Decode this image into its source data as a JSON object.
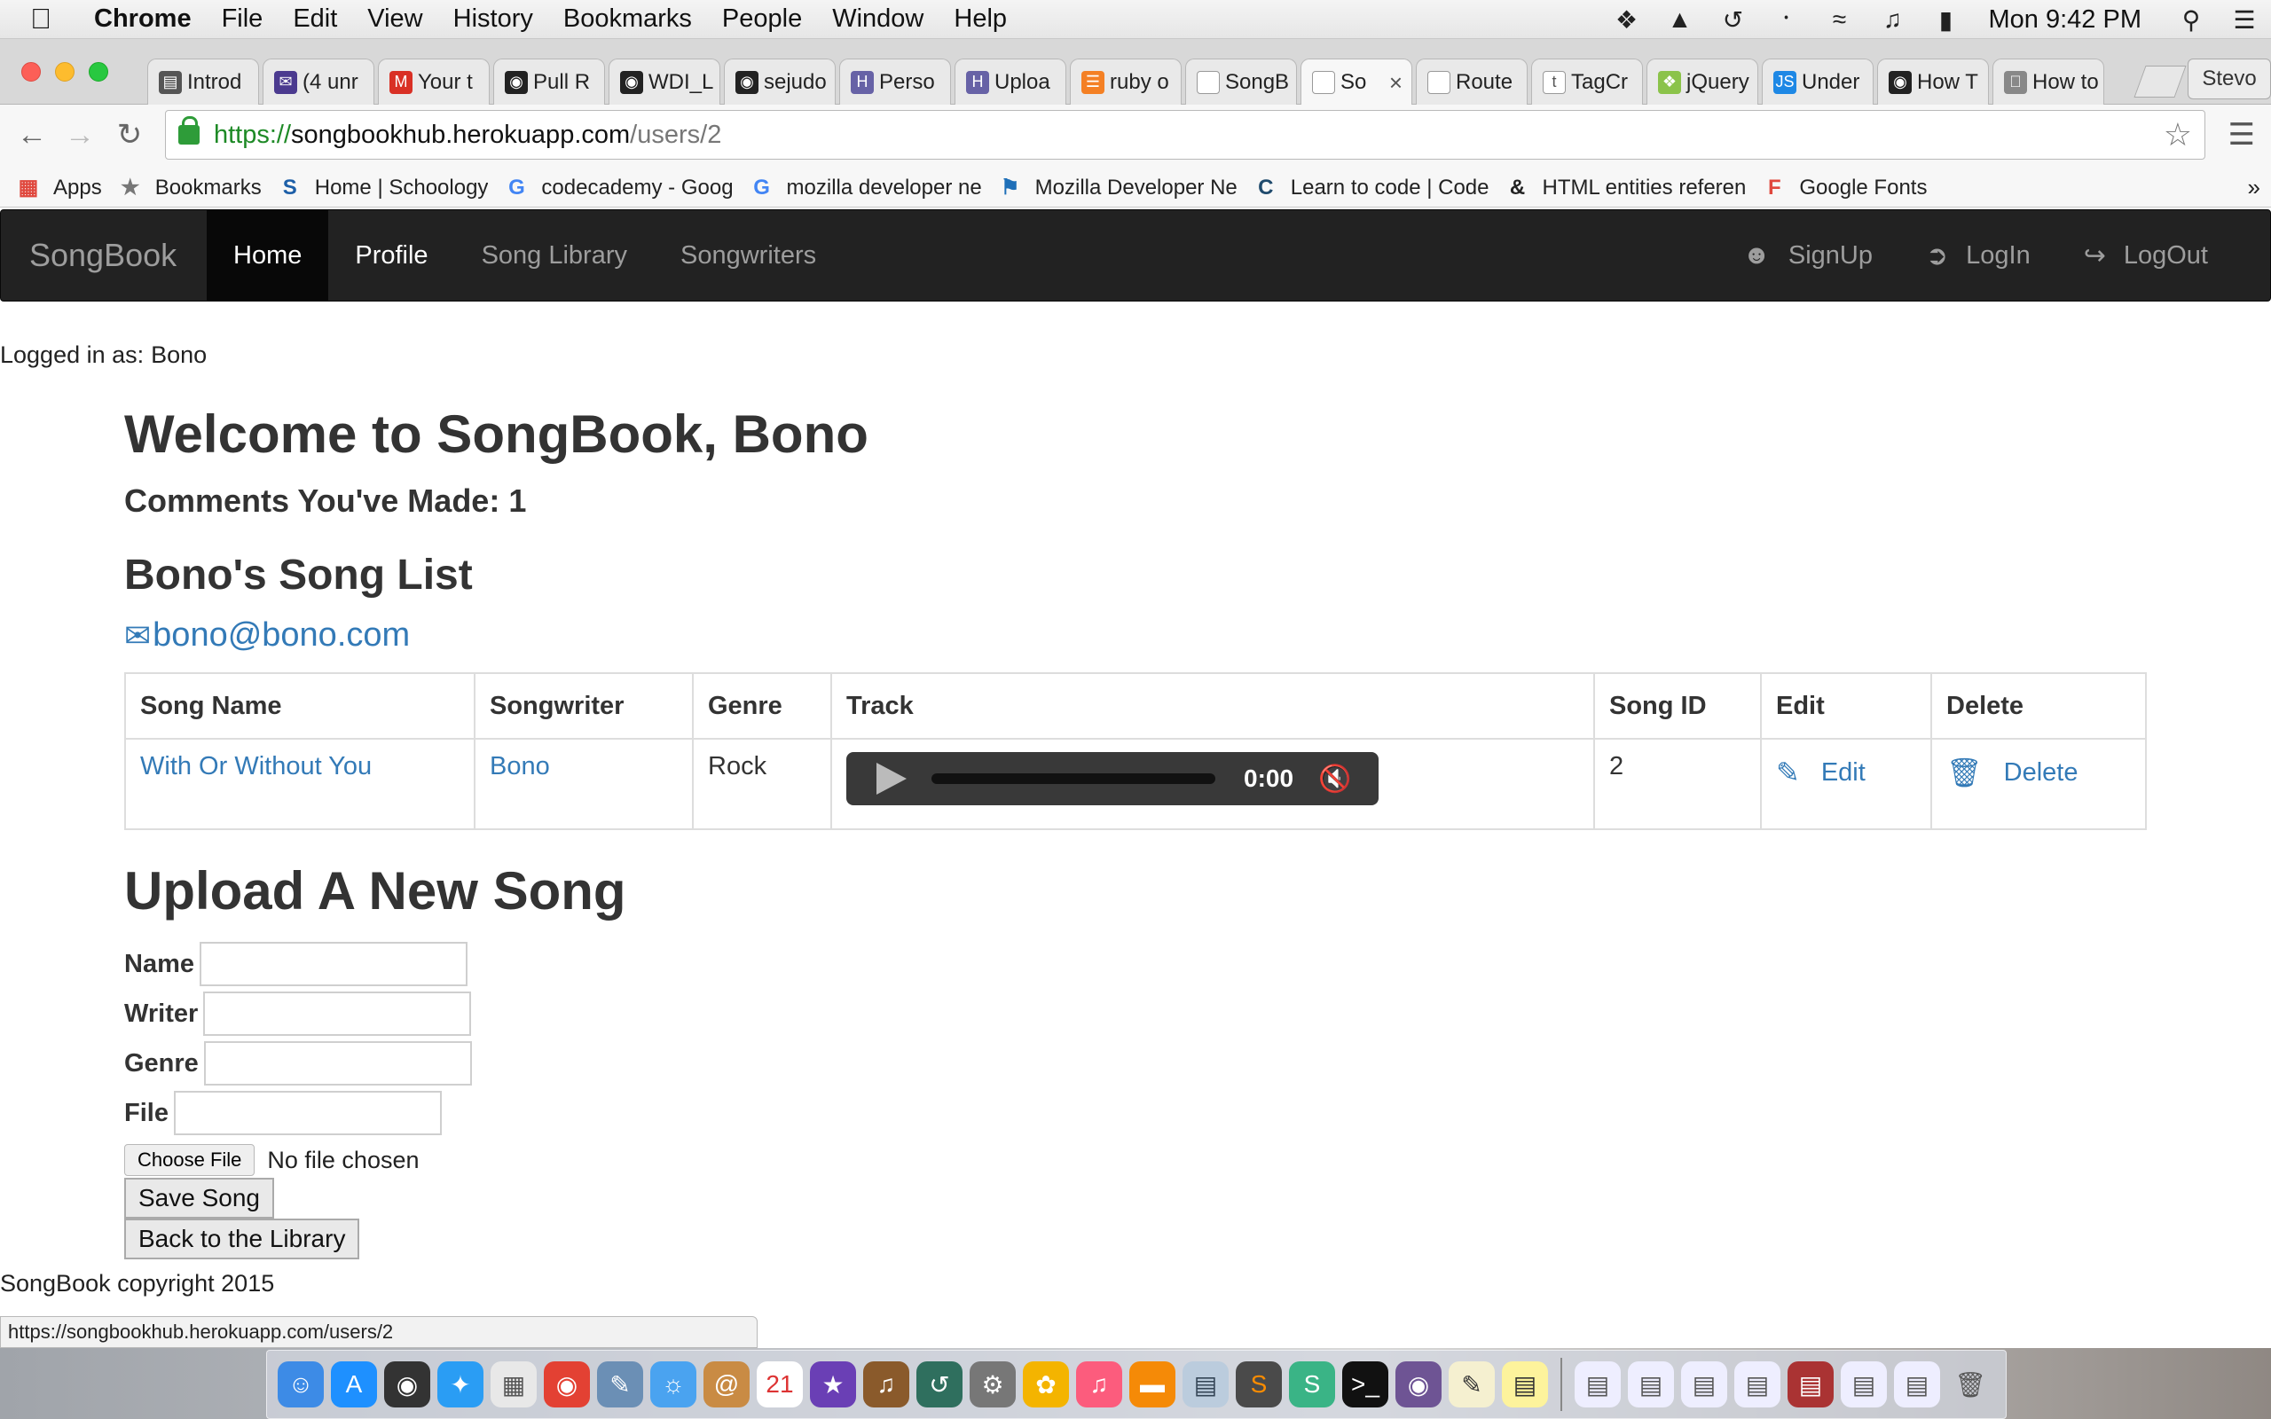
{
  "menubar": {
    "app_name": "Chrome",
    "menus": [
      "File",
      "Edit",
      "View",
      "History",
      "Bookmarks",
      "People",
      "Window",
      "Help"
    ],
    "clock": "Mon 9:42 PM"
  },
  "browser": {
    "profile_name": "Stevo",
    "tabs": [
      {
        "label": "Introd",
        "icon": "book-icon",
        "color": "#555555"
      },
      {
        "label": "(4 unr",
        "icon": "mail-icon",
        "color": "#4b3a8f"
      },
      {
        "label": "Your t",
        "icon": "gmail-icon",
        "color": "#d93025"
      },
      {
        "label": "Pull R",
        "icon": "github-icon",
        "color": "#222222"
      },
      {
        "label": "WDI_L",
        "icon": "github-icon",
        "color": "#222222"
      },
      {
        "label": "sejudo",
        "icon": "github-icon",
        "color": "#222222"
      },
      {
        "label": "Perso",
        "icon": "heroku-icon",
        "color": "#6762a6"
      },
      {
        "label": "Uploa",
        "icon": "heroku-icon",
        "color": "#6762a6"
      },
      {
        "label": "ruby o",
        "icon": "stackoverflow-icon",
        "color": "#f48024"
      },
      {
        "label": "SongB",
        "icon": "page-icon",
        "color": "#ffffff"
      },
      {
        "label": "So",
        "icon": "page-icon",
        "color": "#ffffff",
        "active": true
      },
      {
        "label": "Route",
        "icon": "page-icon",
        "color": "#ffffff"
      },
      {
        "label": "TagCr",
        "icon": "tagcrowd-icon",
        "color": "#ffffff"
      },
      {
        "label": "jQuery",
        "icon": "jquery-icon",
        "color": "#8bc34a"
      },
      {
        "label": "Under",
        "icon": "js-icon",
        "color": "#1e88e5"
      },
      {
        "label": "How T",
        "icon": "github-icon",
        "color": "#222222"
      },
      {
        "label": "How to",
        "icon": "apple-icon",
        "color": "#888888"
      }
    ],
    "url": {
      "scheme": "https://",
      "host": "songbookhub.herokuapp.com",
      "path": "/users/2"
    },
    "bookmarks": [
      {
        "label": "Apps",
        "icon": "apps-grid-icon"
      },
      {
        "label": "Bookmarks",
        "icon": "star-icon"
      },
      {
        "label": "Home | Schoology",
        "icon": "schoology-icon"
      },
      {
        "label": "codecademy - Goog",
        "icon": "google-icon"
      },
      {
        "label": "mozilla developer ne",
        "icon": "google-icon"
      },
      {
        "label": "Mozilla Developer Ne",
        "icon": "mdn-icon"
      },
      {
        "label": "Learn to code | Code",
        "icon": "codecademy-icon"
      },
      {
        "label": "HTML entities referen",
        "icon": "ampersand-icon"
      },
      {
        "label": "Google Fonts",
        "icon": "google-fonts-icon"
      }
    ],
    "status_url": "https://songbookhub.herokuapp.com/users/2"
  },
  "navbar": {
    "brand": "SongBook",
    "links": [
      "Home",
      "Profile",
      "Song Library",
      "Songwriters"
    ],
    "right_links": [
      {
        "label": "SignUp",
        "icon": "user-icon"
      },
      {
        "label": "LogIn",
        "icon": "log-in-icon"
      },
      {
        "label": "LogOut",
        "icon": "log-out-icon"
      }
    ]
  },
  "page": {
    "logged_in_label": "Logged in as:",
    "logged_in_user": "Bono",
    "welcome": "Welcome to SongBook, Bono",
    "comments": "Comments You've Made: 1",
    "song_list_heading": "Bono's Song List",
    "email": "bono@bono.com",
    "table": {
      "headers": [
        "Song Name",
        "Songwriter",
        "Genre",
        "Track",
        "Song ID",
        "Edit",
        "Delete"
      ],
      "rows": [
        {
          "song_name": "With Or Without You",
          "songwriter": "Bono",
          "genre": "Rock",
          "track_time": "0:00",
          "song_id": "2",
          "edit_label": "Edit",
          "delete_label": "Delete"
        }
      ]
    },
    "upload_heading": "Upload A New Song",
    "form": {
      "name_label": "Name",
      "writer_label": "Writer",
      "genre_label": "Genre",
      "file_label": "File",
      "choose_file": "Choose File",
      "no_file": "No file chosen",
      "save_button": "Save Song",
      "back_button": "Back to the Library"
    },
    "copyright": "SongBook copyright 2015"
  }
}
